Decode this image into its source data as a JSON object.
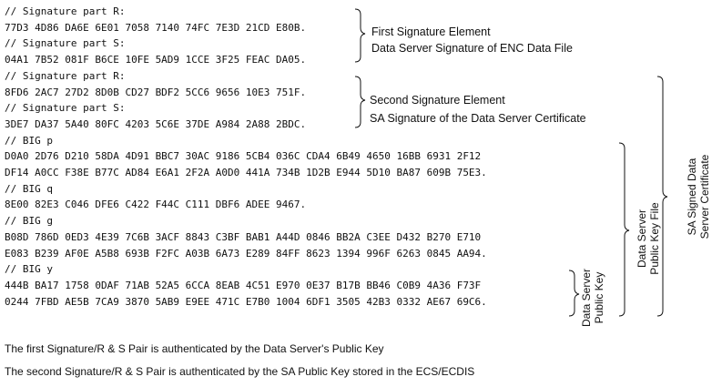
{
  "code_lines": [
    "// Signature part R:",
    "77D3 4D86 DA6E 6E01 7058 7140 74FC 7E3D 21CD E80B.",
    "// Signature part S:",
    "04A1 7B52 081F B6CE 10FE 5AD9 1CCE 3F25 FEAC DA05.",
    "// Signature part R:",
    "8FD6 2AC7 27D2 8D0B CD27 BDF2 5CC6 9656 10E3 751F.",
    "// Signature part S:",
    "3DE7 DA37 5A40 80FC 4203 5C6E 37DE A984 2A88 2BDC.",
    "// BIG p",
    "D0A0 2D76 D210 58DA 4D91 BBC7 30AC 9186 5CB4 036C CDA4 6B49 4650 16BB 6931 2F12",
    "DF14 A0CC F38E B77C AD84 E6A1 2F2A A0D0 441A 734B 1D2B E944 5D10 BA87 609B 75E3.",
    "// BIG q",
    "8E00 82E3 C046 DFE6 C422 F44C C111 DBF6 ADEE 9467.",
    "// BIG g",
    "B08D 786D 0ED3 4E39 7C6B 3ACF 8843 C3BF BAB1 A44D 0846 BB2A C3EE D432 B270 E710",
    "E083 B239 AF0E A5B8 693B F2FC A03B 6A73 E289 84FF 8623 1394 996F 6263 0845 AA94.",
    "// BIG y",
    "444B BA17 1758 0DAF 71AB 52A5 6CCA 8EAB 4C51 E970 0E37 B17B BB46 C0B9 4A36 F73F",
    "0244 7FBD AE5B 7CA9 3870 5AB9 E9EE 471C E7B0 1004 6DF1 3505 42B3 0332 AE67 69C6."
  ],
  "first_element": {
    "title": "First Signature Element",
    "subtitle": "Data Server Signature of ENC Data File"
  },
  "second_element": {
    "title": "Second Signature Element",
    "subtitle": "SA Signature of the Data Server Certificate"
  },
  "labels": {
    "data_server_public_key": [
      "Data Server",
      "Public Key"
    ],
    "data_server_public_key_file": [
      "Data Server",
      "Public Key File"
    ],
    "sa_signed_certificate": [
      "SA Signed Data",
      "Server Certificate"
    ]
  },
  "footer": [
    "The first Signature/R & S Pair is authenticated by the Data Server's Public Key",
    "The second Signature/R & S Pair is authenticated by the SA Public Key stored in the ECS/ECDIS"
  ]
}
